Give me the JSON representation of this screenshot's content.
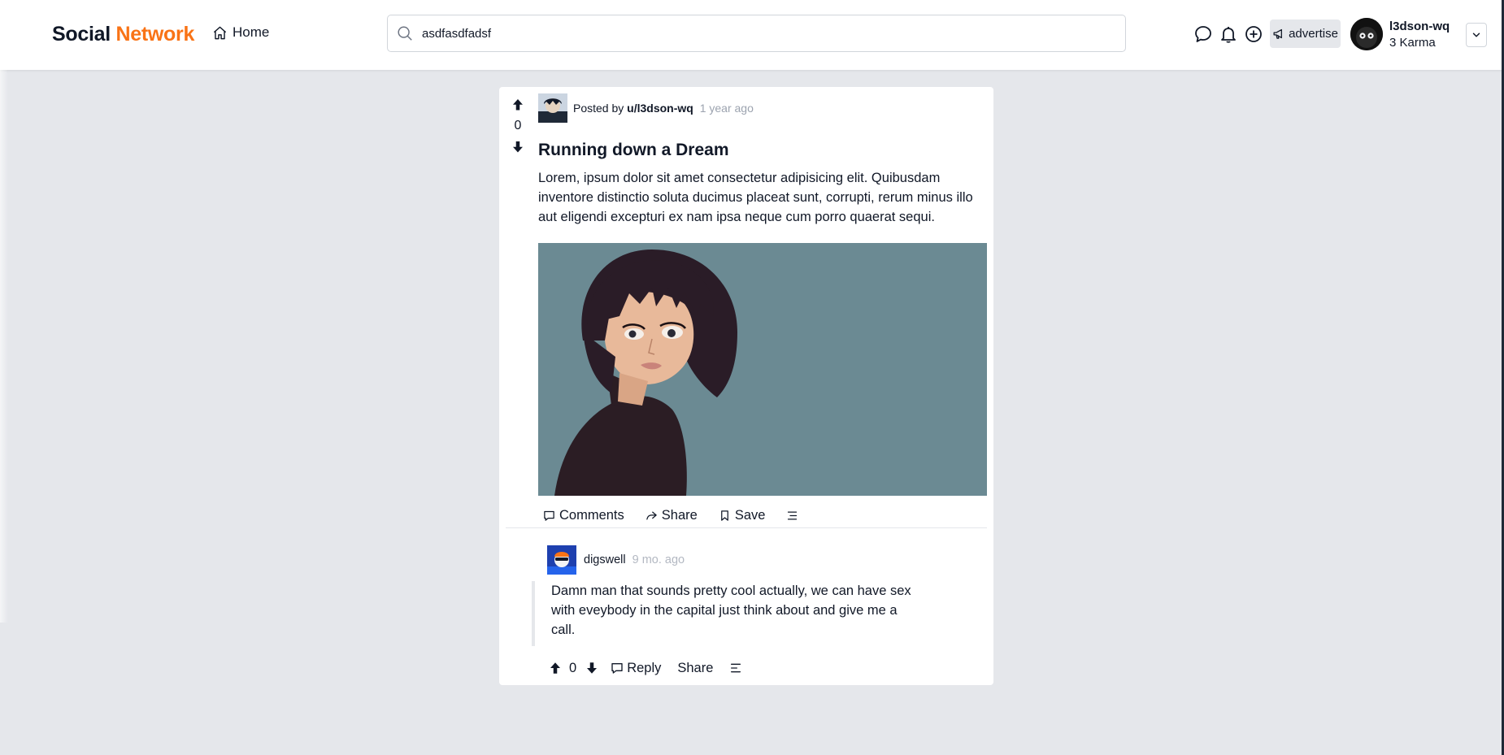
{
  "header": {
    "logo_primary": "Social",
    "logo_accent": "Network",
    "home_label": "Home",
    "search_value": "asdfasdfadsf",
    "advertise_label": "advertise",
    "user": {
      "name": "l3dson-wq",
      "karma": "3 Karma"
    }
  },
  "post": {
    "vote_count": "0",
    "posted_by_prefix": "Posted by",
    "author": "u/l3dson-wq",
    "time": "1 year ago",
    "title": "Running down a Dream",
    "body": "Lorem, ipsum dolor sit amet consectetur adipisicing elit. Quibusdam inventore distinctio soluta ducimus placeat sunt, corrupti, rerum minus illo aut eligendi excepturi ex nam ipsa neque cum porro quaerat sequi.",
    "actions": {
      "comments": "Comments",
      "share": "Share",
      "save": "Save"
    }
  },
  "comment": {
    "author": "digswell",
    "time": "9 mo. ago",
    "text": "Damn man that sounds pretty cool actually, we can have sex with eveybody in the capital just think about and give me a call.",
    "vote_count": "0",
    "reply_label": "Reply",
    "share_label": "Share"
  },
  "colors": {
    "accent": "#f97316",
    "page_bg": "#e5e7eb",
    "image_bg": "#6b8a93"
  }
}
